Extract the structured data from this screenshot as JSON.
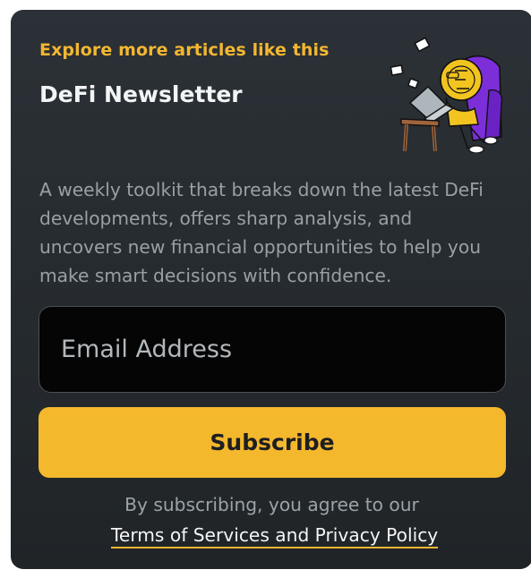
{
  "newsletter": {
    "eyebrow": "Explore more articles like this",
    "title": "DeFi Newsletter",
    "description": "A weekly toolkit that breaks down the latest DeFi developments, offers sharp analysis, and uncovers new financial opportunities to help you make smart decisions with confidence.",
    "email_placeholder": "Email Address",
    "subscribe_label": "Subscribe",
    "consent_text": "By subscribing, you agree to our",
    "policy_link": "Terms of Services and Privacy Policy",
    "illustration_icon": "coin-character-laptop-armchair-icon"
  },
  "colors": {
    "card_background": "#262b2f",
    "accent": "#f4b731",
    "button": "#f4b82d",
    "input_background": "#050505",
    "title_text": "#f3f4f5",
    "muted_text": "#98a0a6"
  }
}
